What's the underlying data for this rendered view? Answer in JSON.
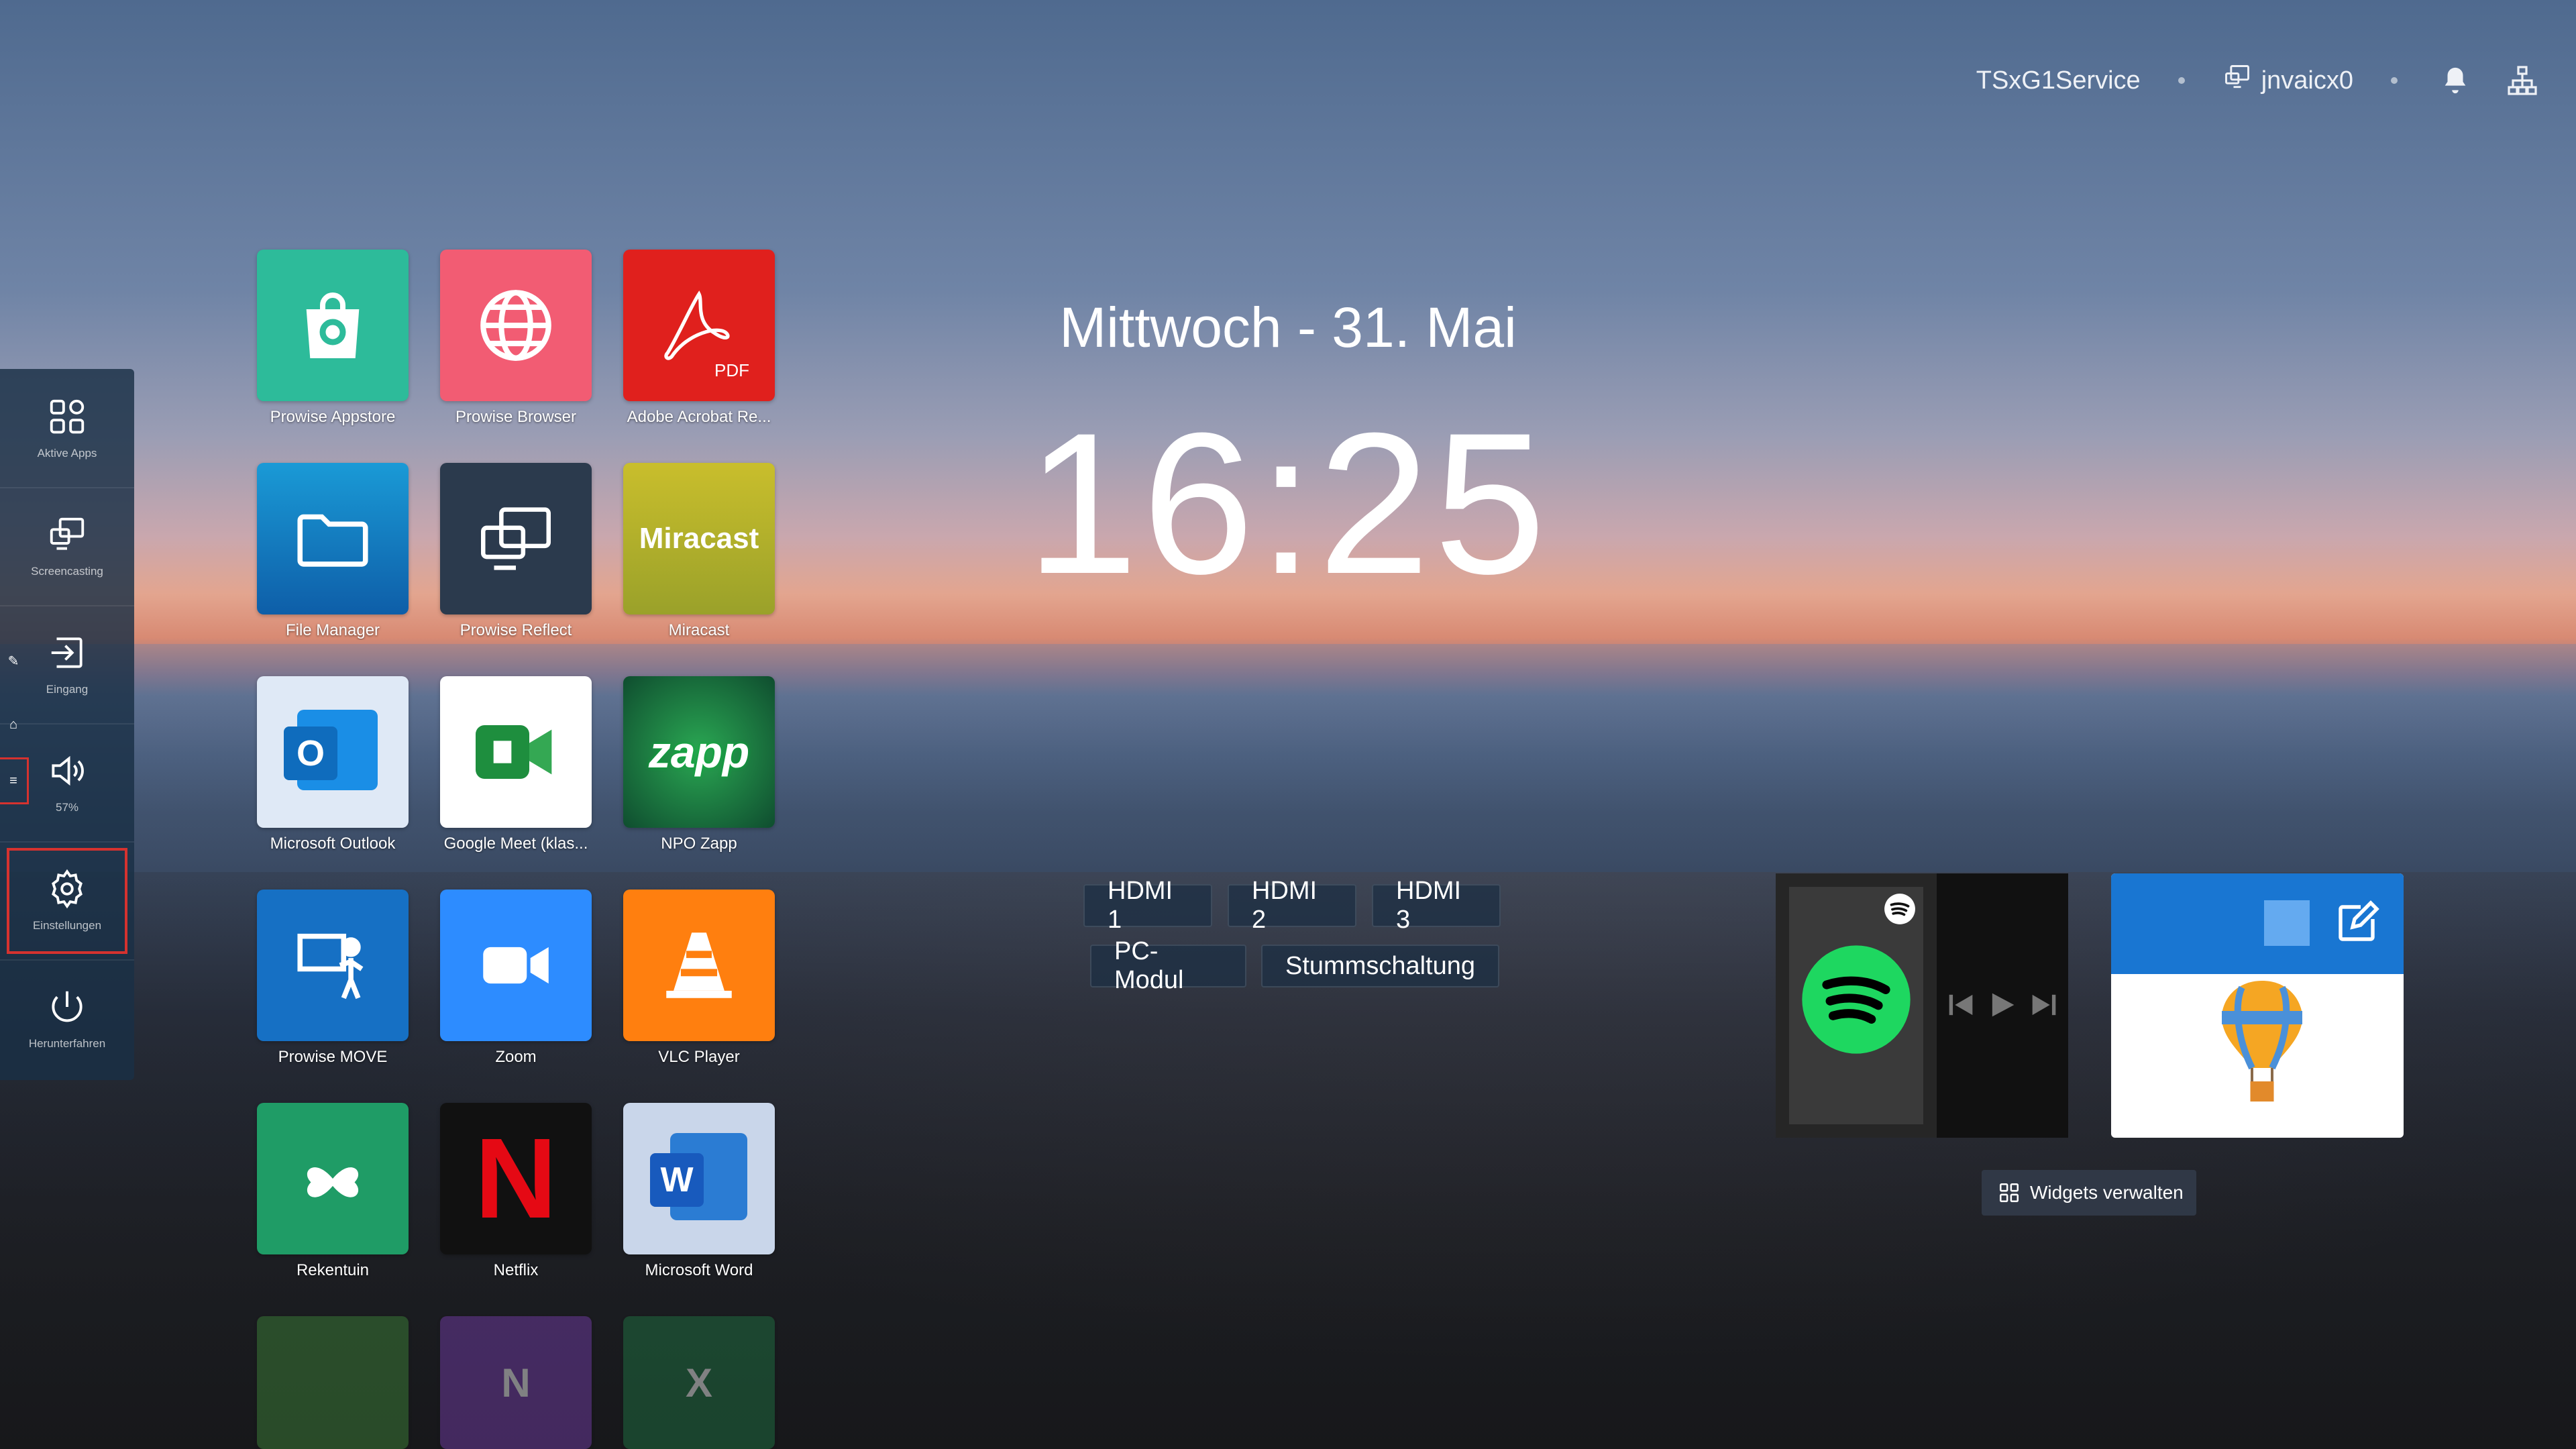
{
  "topbar": {
    "device_name": "TSxG1Service",
    "screen_share_name": "jnvaicx0",
    "icons": [
      "cast-icon",
      "bell-icon",
      "network-icon"
    ]
  },
  "sidebar": {
    "items": [
      {
        "label": "Aktive Apps",
        "icon": "apps-icon"
      },
      {
        "label": "Screencasting",
        "icon": "screencast-icon"
      },
      {
        "label": "Eingang",
        "icon": "input-icon"
      },
      {
        "label": "57%",
        "icon": "volume-icon"
      },
      {
        "label": "Einstellungen",
        "icon": "settings-icon"
      },
      {
        "label": "Herunterfahren",
        "icon": "power-icon"
      }
    ],
    "mini_icons": [
      "pen-icon",
      "home-icon",
      "menu-icon"
    ]
  },
  "apps": [
    {
      "name": "Prowise Appstore",
      "color": "#2dbb9a"
    },
    {
      "name": "Prowise Browser",
      "color": "#f25c73"
    },
    {
      "name": "Adobe Acrobat Re...",
      "color": "#e0201d"
    },
    {
      "name": "File Manager",
      "color": "#1483c8"
    },
    {
      "name": "Prowise Reflect",
      "color": "#2b3a4d"
    },
    {
      "name": "Miracast",
      "color": "#b4b82b"
    },
    {
      "name": "Microsoft Outlook",
      "color": "#dfe9f6"
    },
    {
      "name": "Google Meet (klas...",
      "color": "#ffffff"
    },
    {
      "name": "NPO Zapp",
      "color": "#0f4d2f"
    },
    {
      "name": "Prowise MOVE",
      "color": "#1670c4"
    },
    {
      "name": "Zoom",
      "color": "#2d8cff"
    },
    {
      "name": "VLC Player",
      "color": "#ff7f0f"
    },
    {
      "name": "Rekentuin",
      "color": "#1f9c66"
    },
    {
      "name": "Netflix",
      "color": "#111111"
    },
    {
      "name": "Microsoft Word",
      "color": "#c9d6ea"
    }
  ],
  "date_text": "Mittwoch - 31. Mai",
  "time_text": "16:25",
  "inputs": [
    "HDMI 1",
    "HDMI 2",
    "HDMI 3",
    "PC-Modul",
    "Stummschaltung"
  ],
  "widgets": {
    "manage_label": "Widgets verwalten",
    "acrobat_badge": "PDF",
    "miracast_text": "Miracast",
    "zapp_text": "zapp",
    "outlook_letter": "O",
    "word_letter": "W",
    "netflix_letter": "N"
  },
  "faded_row_letters": [
    "",
    "N",
    "X"
  ]
}
